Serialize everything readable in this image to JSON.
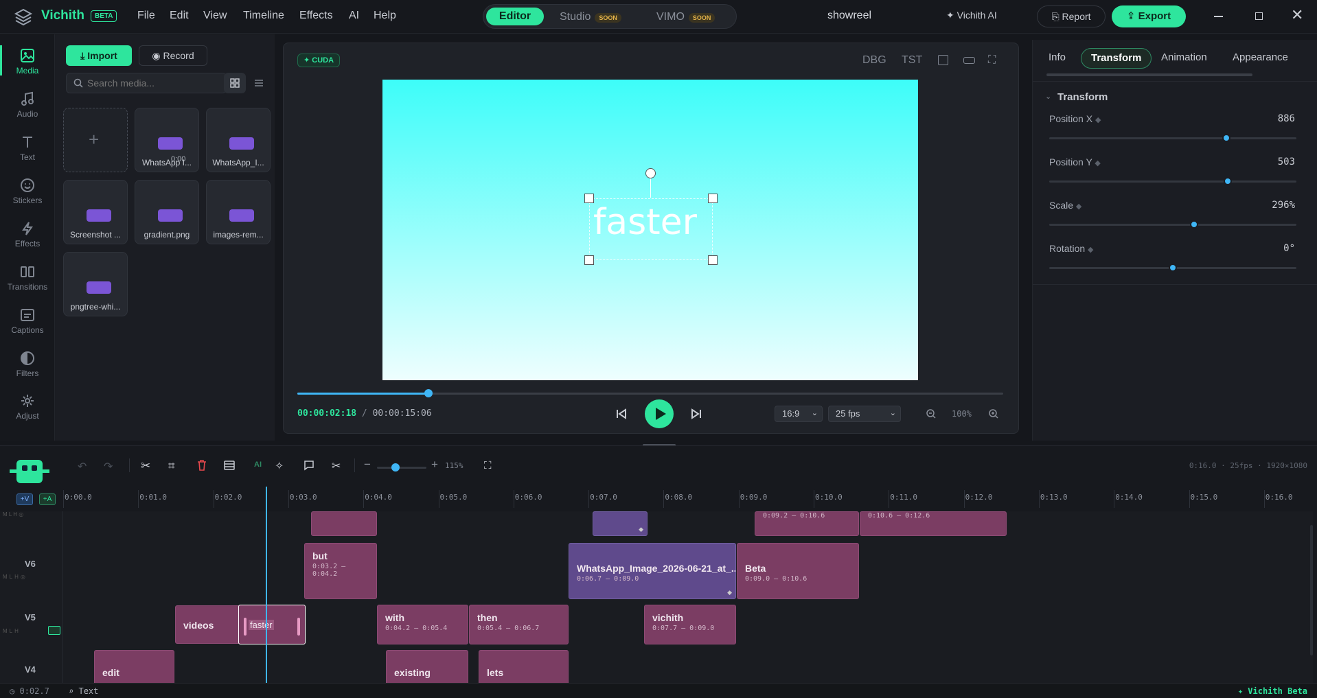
{
  "app": {
    "name": "Vichith",
    "beta": "BETA",
    "project": "showreel"
  },
  "menu": [
    "File",
    "Edit",
    "View",
    "Timeline",
    "Effects",
    "AI",
    "Help"
  ],
  "modes": {
    "editor": "Editor",
    "studio": "Studio",
    "vimo": "VIMO",
    "soon": "SOON"
  },
  "header": {
    "ai": "Vichith AI",
    "report": "Report",
    "export": "Export"
  },
  "rail": [
    {
      "label": "Media",
      "icon": "image-icon"
    },
    {
      "label": "Audio",
      "icon": "music-icon"
    },
    {
      "label": "Text",
      "icon": "text-icon"
    },
    {
      "label": "Stickers",
      "icon": "smile-icon"
    },
    {
      "label": "Effects",
      "icon": "bolt-icon"
    },
    {
      "label": "Transitions",
      "icon": "transitions-icon"
    },
    {
      "label": "Captions",
      "icon": "captions-icon"
    },
    {
      "label": "Filters",
      "icon": "filter-icon"
    },
    {
      "label": "Adjust",
      "icon": "adjust-icon"
    }
  ],
  "media": {
    "import": "Import",
    "record": "Record",
    "search_placeholder": "Search media...",
    "tiles": [
      {
        "name": "WhatsApp I...",
        "duration": "0:00"
      },
      {
        "name": "WhatsApp_I..."
      },
      {
        "name": "Screenshot ..."
      },
      {
        "name": "gradient.png"
      },
      {
        "name": "images-rem..."
      },
      {
        "name": "pngtree-whi..."
      }
    ]
  },
  "preview": {
    "cuda": "CUDA",
    "dbg": "DBG",
    "tst": "TST",
    "canvas_text": "faster",
    "current_time": "00:00:02:18",
    "separator": "/",
    "total_time": "00:00:15:06",
    "aspect": "16:9",
    "fps": "25 fps",
    "zoom": "100%",
    "scrub_fraction": 0.186,
    "gradient_top": "#3dfdf9",
    "gradient_bottom": "#eefefe"
  },
  "inspector": {
    "tabs": [
      "Info",
      "Transform",
      "Animation",
      "Appearance"
    ],
    "active_tab": "Transform",
    "section": "Transform",
    "props": [
      {
        "label": "Position X",
        "value": "886",
        "level": 0.718
      },
      {
        "label": "Position Y",
        "value": "503",
        "level": 0.721
      },
      {
        "label": "Scale",
        "value": "296%",
        "level": 0.586
      },
      {
        "label": "Rotation",
        "value": "0°",
        "level": 0.5
      }
    ]
  },
  "timeline": {
    "ai_label": "AI",
    "zoom": "115%",
    "zoom_level": 0.38,
    "info": "0:16.0 · 25fps · 1920×1080",
    "add_video": "+V",
    "add_audio": "+A",
    "ruler": [
      "0:00.0",
      "0:01.0",
      "0:02.0",
      "0:03.0",
      "0:04.0",
      "0:05.0",
      "0:06.0",
      "0:07.0",
      "0:08.0",
      "0:09.0",
      "0:10.0",
      "0:11.0",
      "0:12.0",
      "0:13.0",
      "0:14.0",
      "0:15.0",
      "0:16.0"
    ],
    "tracks": [
      "V6",
      "V5",
      "V4"
    ],
    "clips_top": [
      {
        "name": "",
        "time": ""
      },
      {
        "name": "",
        "time": ""
      },
      {
        "name": "",
        "time": "0:09.2 – 0:10.6"
      },
      {
        "name": "",
        "time": "0:10.6 – 0:12.6"
      }
    ],
    "clips_v6": [
      {
        "name": "but",
        "time": "0:03.2 –\n0:04.2"
      },
      {
        "name": "WhatsApp_Image_2026-06-21_at_...",
        "time": "0:06.7 – 0:09.0"
      },
      {
        "name": "Beta",
        "time": "0:09.0 – 0:10.6"
      }
    ],
    "clips_v5": [
      {
        "name": "videos",
        "time": ""
      },
      {
        "name": "faster",
        "time": ""
      },
      {
        "name": "with",
        "time": "0:04.2 – 0:05.4"
      },
      {
        "name": "then",
        "time": "0:05.4 – 0:06.7"
      },
      {
        "name": "vichith",
        "time": "0:07.7 – 0:09.0"
      }
    ],
    "clips_v4": [
      {
        "name": "edit"
      },
      {
        "name": "existing"
      },
      {
        "name": "lets"
      }
    ]
  },
  "status": {
    "time": "0:02.7",
    "selection": "Text",
    "brand": "Vichith Beta"
  }
}
